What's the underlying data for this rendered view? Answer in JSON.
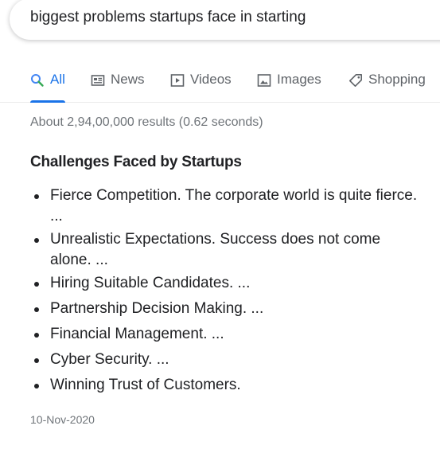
{
  "search": {
    "query": "biggest problems startups face in starting"
  },
  "tabs": [
    {
      "label": "All",
      "icon": "search-icon",
      "active": true
    },
    {
      "label": "News",
      "icon": "news-icon",
      "active": false
    },
    {
      "label": "Videos",
      "icon": "video-icon",
      "active": false
    },
    {
      "label": "Images",
      "icon": "image-icon",
      "active": false
    },
    {
      "label": "Shopping",
      "icon": "tag-icon",
      "active": false
    }
  ],
  "result_stats": "About 2,94,00,000 results (0.62 seconds)",
  "snippet": {
    "heading": "Challenges Faced by Startups",
    "items": [
      {
        "line1": "Fierce Competition. The corporate world is quite fierce.",
        "line2": "..."
      },
      {
        "line1": "Unrealistic Expectations. Success does not come",
        "line2": "alone. ..."
      },
      {
        "line1": "Hiring Suitable Candidates. ..."
      },
      {
        "line1": "Partnership Decision Making. ..."
      },
      {
        "line1": "Financial Management. ..."
      },
      {
        "line1": "Cyber Security. ..."
      },
      {
        "line1": "Winning Trust of Customers."
      }
    ],
    "date": "10-Nov-2020"
  },
  "colors": {
    "accent": "#1a73e8",
    "text": "#202124",
    "muted": "#70757a",
    "icon": "#5f6368"
  }
}
